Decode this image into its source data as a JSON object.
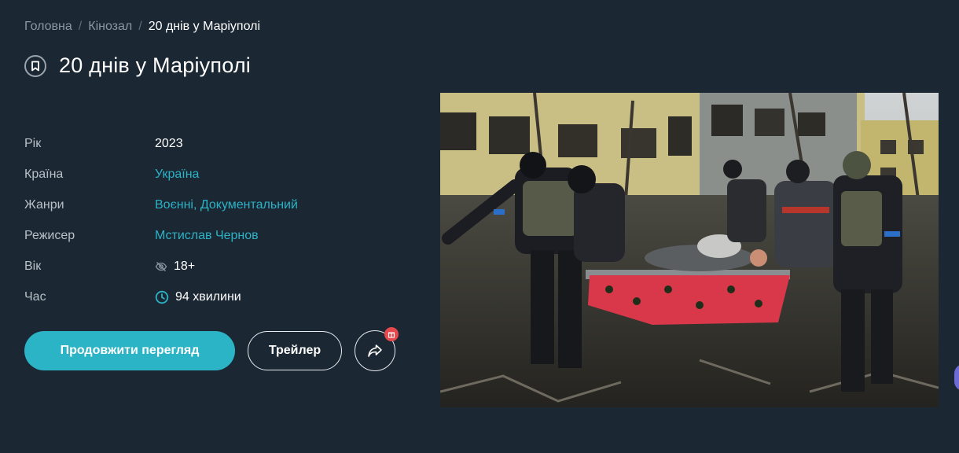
{
  "breadcrumb": {
    "items": [
      "Головна",
      "Кінозал",
      "20 днів у Маріуполі"
    ],
    "separator": "/"
  },
  "title": "20 днів у Маріуполі",
  "info": {
    "year_label": "Рік",
    "year": "2023",
    "country_label": "Країна",
    "country": "Україна",
    "genres_label": "Жанри",
    "genres": "Воєнні, Документальний",
    "director_label": "Режисер",
    "director": "Мстислав Чернов",
    "age_label": "Вік",
    "age": "18+",
    "duration_label": "Час",
    "duration": "94 хвилини"
  },
  "actions": {
    "continue_label": "Продовжити перегляд",
    "trailer_label": "Трейлер"
  },
  "icons": {
    "bookmark": "bookmark-icon",
    "age": "eye-off-icon",
    "duration": "clock-icon",
    "share": "share-icon",
    "gift": "gift-icon"
  },
  "colors": {
    "background": "#1b2733",
    "accent": "#2bb3c6",
    "badge": "#e5484d"
  }
}
